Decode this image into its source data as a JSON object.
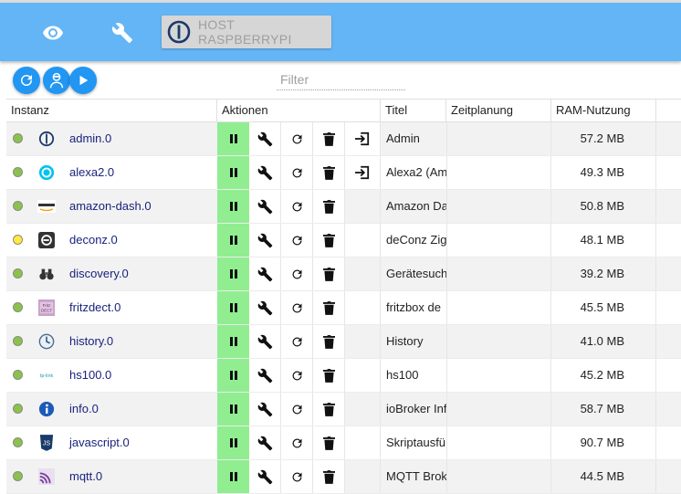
{
  "toolbar": {
    "host_label": "HOST RASPBERRYPI",
    "icons": [
      "eye-icon",
      "wrench-icon",
      "iobroker-logo-icon"
    ]
  },
  "actions_bar": {
    "filter_placeholder": "Filter",
    "buttons": [
      "refresh-icon",
      "expert-mode-icon",
      "play-icon"
    ]
  },
  "columns": {
    "instance": "Instanz",
    "actions": "Aktionen",
    "title": "Titel",
    "schedule": "Zeitplanung",
    "ram": "RAM-Nutzung"
  },
  "colors": {
    "header": "#64b5f6",
    "round_button": "#2196f3",
    "status_green": "#8bc34a",
    "status_yellow": "#ffeb3b",
    "pause_active": "#90ee90",
    "instance_link": "#1a237e"
  },
  "rows": [
    {
      "status": "green",
      "icon": "iobroker-admin-icon",
      "name": "admin.0",
      "title": "Admin",
      "schedule": "",
      "ram": "57.2 MB",
      "has_link": true
    },
    {
      "status": "green",
      "icon": "alexa-icon",
      "name": "alexa2.0",
      "title": "Alexa2 (Am",
      "schedule": "",
      "ram": "49.3 MB",
      "has_link": true
    },
    {
      "status": "green",
      "icon": "amazon-icon",
      "name": "amazon-dash.0",
      "title": "Amazon Da",
      "schedule": "",
      "ram": "50.8 MB",
      "has_link": false
    },
    {
      "status": "yellow",
      "icon": "deconz-icon",
      "name": "deconz.0",
      "title": "deConz Zig",
      "schedule": "",
      "ram": "48.1 MB",
      "has_link": false
    },
    {
      "status": "green",
      "icon": "binoculars-icon",
      "name": "discovery.0",
      "title": "Gerätesuch",
      "schedule": "",
      "ram": "39.2 MB",
      "has_link": false
    },
    {
      "status": "green",
      "icon": "fritzdect-icon",
      "name": "fritzdect.0",
      "title": "fritzbox de",
      "schedule": "",
      "ram": "45.5 MB",
      "has_link": false
    },
    {
      "status": "green",
      "icon": "history-icon",
      "name": "history.0",
      "title": "History",
      "schedule": "",
      "ram": "41.0 MB",
      "has_link": false
    },
    {
      "status": "green",
      "icon": "tplink-icon",
      "name": "hs100.0",
      "title": "hs100",
      "schedule": "",
      "ram": "45.2 MB",
      "has_link": false
    },
    {
      "status": "green",
      "icon": "info-icon",
      "name": "info.0",
      "title": "ioBroker Inf",
      "schedule": "",
      "ram": "58.7 MB",
      "has_link": false
    },
    {
      "status": "green",
      "icon": "javascript-icon",
      "name": "javascript.0",
      "title": "Skriptausfü",
      "schedule": "",
      "ram": "90.7 MB",
      "has_link": false
    },
    {
      "status": "green",
      "icon": "mqtt-icon",
      "name": "mqtt.0",
      "title": "MQTT Brok",
      "schedule": "",
      "ram": "44.5 MB",
      "has_link": false
    }
  ]
}
